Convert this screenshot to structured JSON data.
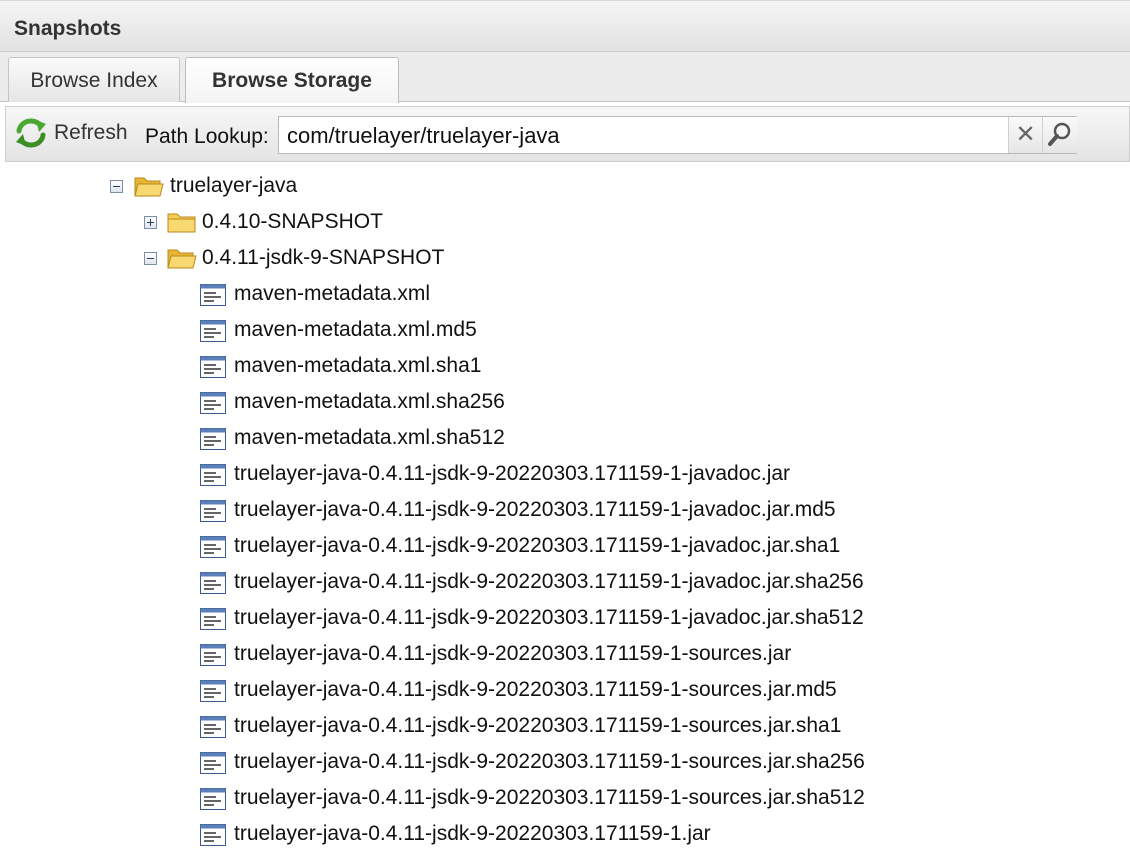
{
  "header": {
    "title": "Snapshots"
  },
  "tabs": [
    {
      "label": "Browse Index",
      "active": false
    },
    {
      "label": "Browse Storage",
      "active": true
    }
  ],
  "toolbar": {
    "refresh_label": "Refresh",
    "path_lookup_label": "Path Lookup:",
    "path_lookup_value": "com/truelayer/truelayer-java",
    "clear_glyph": "✕"
  },
  "tree": {
    "root": {
      "label": "truelayer-java",
      "expanded": true
    },
    "folders": [
      {
        "label": "0.4.10-SNAPSHOT",
        "expanded": false
      },
      {
        "label": "0.4.11-jsdk-9-SNAPSHOT",
        "expanded": true
      }
    ],
    "files": [
      "maven-metadata.xml",
      "maven-metadata.xml.md5",
      "maven-metadata.xml.sha1",
      "maven-metadata.xml.sha256",
      "maven-metadata.xml.sha512",
      "truelayer-java-0.4.11-jsdk-9-20220303.171159-1-javadoc.jar",
      "truelayer-java-0.4.11-jsdk-9-20220303.171159-1-javadoc.jar.md5",
      "truelayer-java-0.4.11-jsdk-9-20220303.171159-1-javadoc.jar.sha1",
      "truelayer-java-0.4.11-jsdk-9-20220303.171159-1-javadoc.jar.sha256",
      "truelayer-java-0.4.11-jsdk-9-20220303.171159-1-javadoc.jar.sha512",
      "truelayer-java-0.4.11-jsdk-9-20220303.171159-1-sources.jar",
      "truelayer-java-0.4.11-jsdk-9-20220303.171159-1-sources.jar.md5",
      "truelayer-java-0.4.11-jsdk-9-20220303.171159-1-sources.jar.sha1",
      "truelayer-java-0.4.11-jsdk-9-20220303.171159-1-sources.jar.sha256",
      "truelayer-java-0.4.11-jsdk-9-20220303.171159-1-sources.jar.sha512",
      "truelayer-java-0.4.11-jsdk-9-20220303.171159-1.jar"
    ]
  },
  "icons": {
    "refresh": "refresh-icon",
    "clear": "clear-icon",
    "search": "search-icon",
    "folder_open": "folder-open-icon",
    "folder_closed": "folder-icon",
    "file": "file-icon",
    "expand": "expand-icon",
    "collapse": "collapse-icon"
  },
  "colors": {
    "folder": "#f2c94c",
    "refresh_green": "#4aa832",
    "file_blue": "#3a5a8c"
  }
}
